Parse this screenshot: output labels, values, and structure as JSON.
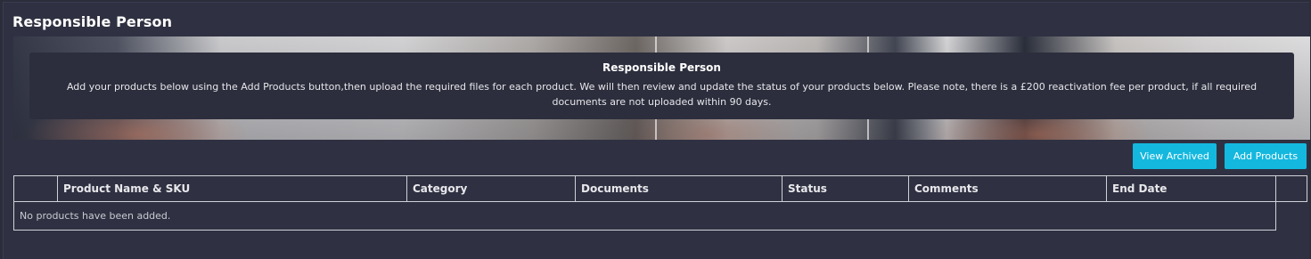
{
  "page": {
    "title": "Responsible Person"
  },
  "notice": {
    "title": "Responsible Person",
    "text": "Add your products below using the Add Products button,then upload the required files for each product. We will then review and update the status of your products below. Please note, there is a £200 reactivation fee per product, if all required documents are not uploaded within 90 days."
  },
  "toolbar": {
    "view_archived_label": "View Archived",
    "add_products_label": "Add Products"
  },
  "table": {
    "columns": [
      "",
      "Product Name & SKU",
      "Category",
      "Documents",
      "Status",
      "Comments",
      "End Date",
      ""
    ],
    "empty_message": "No products have been added."
  },
  "colors": {
    "background": "#2f3142",
    "accent_button": "#14b8df",
    "notice_background": "#2c2e3d"
  }
}
